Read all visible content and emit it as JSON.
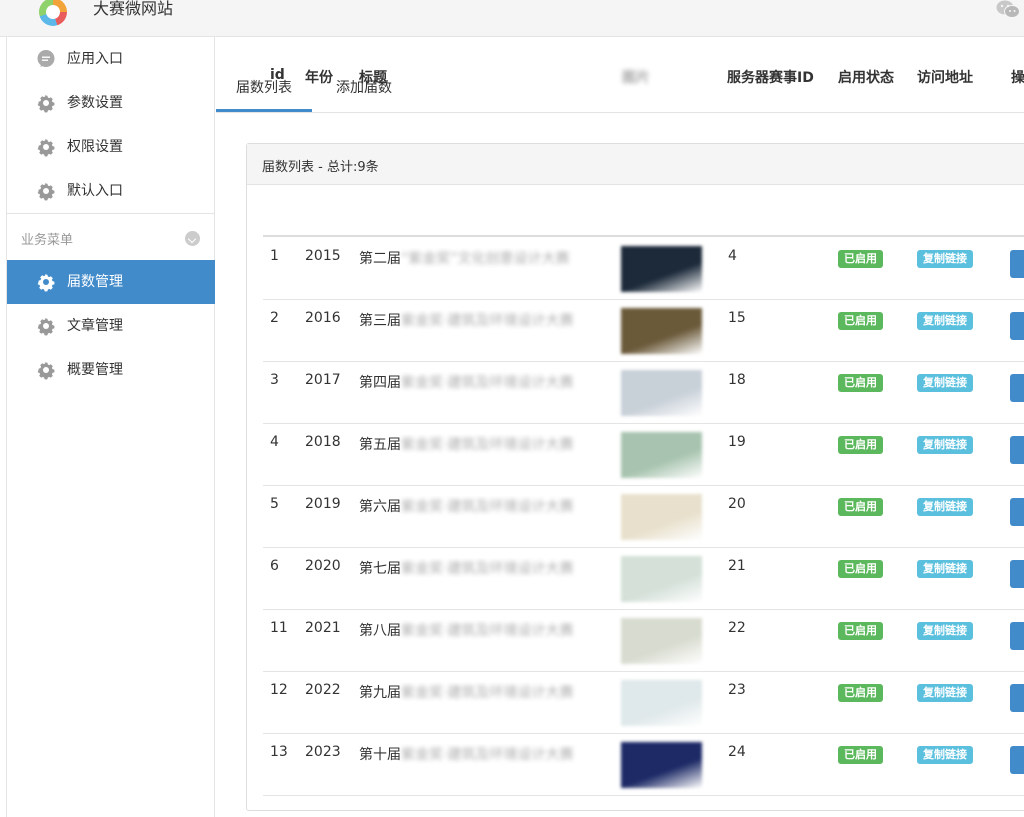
{
  "app": {
    "title": "大赛微网站"
  },
  "sidebar": {
    "items": [
      {
        "label": "应用入口",
        "icon": "chat-icon"
      },
      {
        "label": "参数设置",
        "icon": "gear-icon"
      },
      {
        "label": "权限设置",
        "icon": "gear-icon"
      },
      {
        "label": "默认入口",
        "icon": "gear-icon"
      }
    ],
    "section_label": "业务菜单",
    "biz_items": [
      {
        "label": "届数管理",
        "icon": "gear-icon",
        "active": true
      },
      {
        "label": "文章管理",
        "icon": "gear-icon"
      },
      {
        "label": "概要管理",
        "icon": "gear-icon"
      }
    ]
  },
  "tabs": [
    {
      "label": "届数列表",
      "active": true
    },
    {
      "label": "添加届数"
    }
  ],
  "panel": {
    "title": "届数列表 - 总计:9条"
  },
  "table": {
    "headers": [
      "id",
      "年份",
      "标题",
      "图片",
      "服务器赛事ID",
      "启用状态",
      "访问地址",
      "操"
    ],
    "rows": [
      {
        "id": "1",
        "year": "2015",
        "title_prefix": "第二届",
        "title_rest": "“紫金奖”文化创意设计大赛",
        "server_id": "4",
        "status": "已启用",
        "link": "复制链接",
        "img_color": "#1c2a3a"
      },
      {
        "id": "2",
        "year": "2016",
        "title_prefix": "第三届",
        "title_rest": "紫金奖·建筑及环境设计大赛",
        "server_id": "15",
        "status": "已启用",
        "link": "复制链接",
        "img_color": "#6b5a3a"
      },
      {
        "id": "3",
        "year": "2017",
        "title_prefix": "第四届",
        "title_rest": "紫金奖·建筑及环境设计大赛",
        "server_id": "18",
        "status": "已启用",
        "link": "复制链接",
        "img_color": "#c8d0d8"
      },
      {
        "id": "4",
        "year": "2018",
        "title_prefix": "第五届",
        "title_rest": "紫金奖·建筑及环境设计大赛",
        "server_id": "19",
        "status": "已启用",
        "link": "复制链接",
        "img_color": "#a8c4b0"
      },
      {
        "id": "5",
        "year": "2019",
        "title_prefix": "第六届",
        "title_rest": "紫金奖·建筑及环境设计大赛",
        "server_id": "20",
        "status": "已启用",
        "link": "复制链接",
        "img_color": "#e8e0cc"
      },
      {
        "id": "6",
        "year": "2020",
        "title_prefix": "第七届",
        "title_rest": "紫金奖·建筑及环境设计大赛",
        "server_id": "21",
        "status": "已启用",
        "link": "复制链接",
        "img_color": "#d4e0d8"
      },
      {
        "id": "11",
        "year": "2021",
        "title_prefix": "第八届",
        "title_rest": "紫金奖·建筑及环境设计大赛",
        "server_id": "22",
        "status": "已启用",
        "link": "复制链接",
        "img_color": "#d8dcd0"
      },
      {
        "id": "12",
        "year": "2022",
        "title_prefix": "第九届",
        "title_rest": "紫金奖·建筑及环境设计大赛",
        "server_id": "23",
        "status": "已启用",
        "link": "复制链接",
        "img_color": "#dfe8ea"
      },
      {
        "id": "13",
        "year": "2023",
        "title_prefix": "第十届",
        "title_rest": "紫金奖·建筑及环境设计大赛",
        "server_id": "24",
        "status": "已启用",
        "link": "复制链接",
        "img_color": "#1d2a66"
      }
    ]
  },
  "colors": {
    "accent": "#428bca",
    "success": "#5cb85c",
    "info": "#5bc0de"
  }
}
